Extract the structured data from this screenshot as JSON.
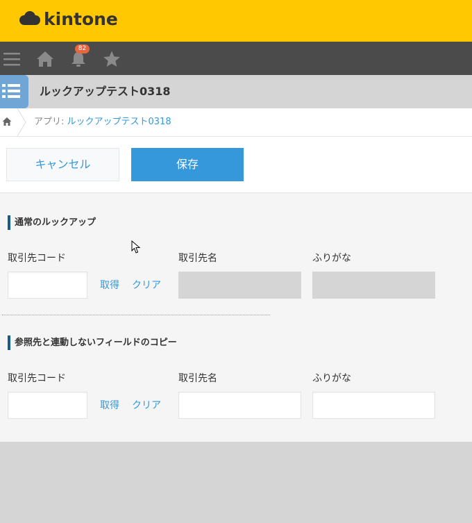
{
  "header": {
    "logo_text": "kintone",
    "brand_color": "#ffc800"
  },
  "nav": {
    "icons": [
      "menu-icon",
      "home-icon",
      "bell-icon",
      "star-icon"
    ],
    "notification_count": "82"
  },
  "app": {
    "title": "ルックアップテスト0318",
    "icon": "list-icon",
    "icon_color": "#6fa6d6"
  },
  "breadcrumb": {
    "prefix": "アプリ: ",
    "app_link": "ルックアップテスト0318"
  },
  "actions": {
    "cancel_label": "キャンセル",
    "save_label": "保存",
    "accent_color": "#3498db"
  },
  "sections": [
    {
      "title": "通常のルックアップ",
      "code_label": "取引先コード",
      "get_label": "取得",
      "clear_label": "クリア",
      "name_label": "取引先名",
      "furigana_label": "ふりがな",
      "code_value": "",
      "name_value": "",
      "furigana_value": ""
    },
    {
      "title": "参照先と連動しないフィールドのコピー",
      "code_label": "取引先コード",
      "get_label": "取得",
      "clear_label": "クリア",
      "name_label": "取引先名",
      "furigana_label": "ふりがな",
      "code_value": "",
      "name_value": "",
      "furigana_value": ""
    }
  ]
}
